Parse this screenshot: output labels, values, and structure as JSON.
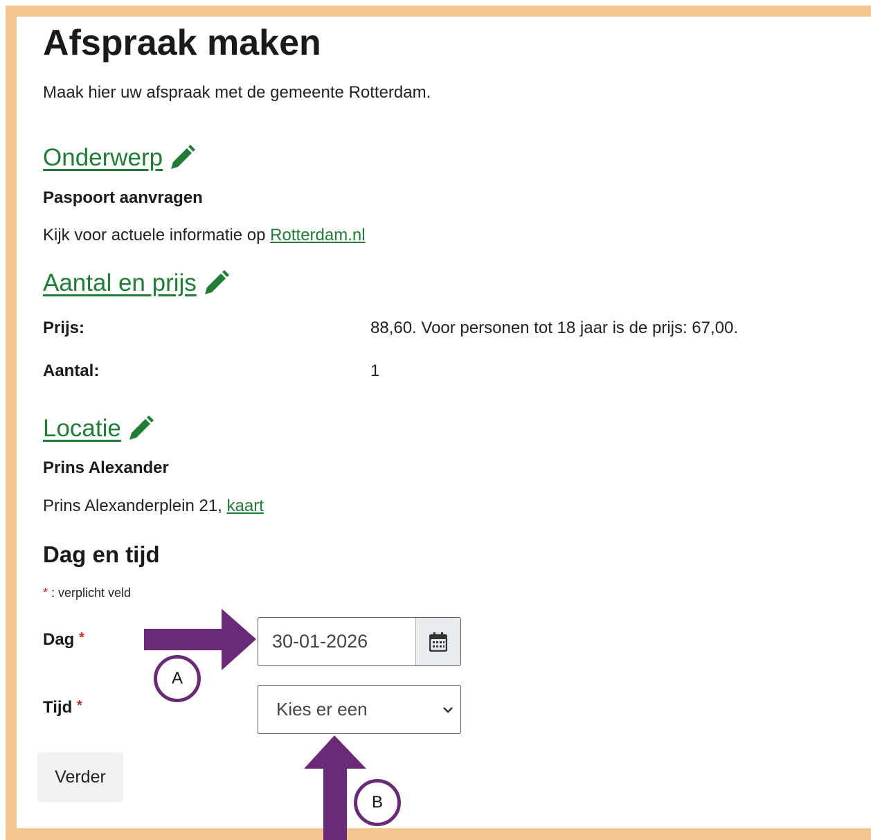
{
  "page": {
    "title": "Afspraak maken",
    "intro": "Maak hier uw afspraak met de gemeente Rotterdam."
  },
  "onderwerp": {
    "heading": "Onderwerp",
    "value": "Paspoort aanvragen",
    "info_prefix": "Kijk voor actuele informatie op ",
    "info_link": "Rotterdam.nl"
  },
  "aantal": {
    "heading": "Aantal en prijs",
    "price_label": "Prijs:",
    "price_value": "88,60. Voor personen tot 18 jaar is de prijs: 67,00.",
    "count_label": "Aantal:",
    "count_value": "1"
  },
  "locatie": {
    "heading": "Locatie",
    "name": "Prins Alexander",
    "address": "Prins Alexanderplein 21, ",
    "map_link": "kaart"
  },
  "dagtijd": {
    "heading": "Dag en tijd",
    "required_star": "*",
    "required_note": " : verplicht veld",
    "day_label": "Dag",
    "day_value": "30-01-2026",
    "time_label": "Tijd",
    "time_placeholder": "Kies er een"
  },
  "submit_label": "Verder",
  "annotations": {
    "a": "A",
    "b": "B",
    "arrow_color": "#6a2a78"
  },
  "colors": {
    "frame": "#f4c78f",
    "link_green": "#1e7e34",
    "required_red": "#d52b1e"
  }
}
